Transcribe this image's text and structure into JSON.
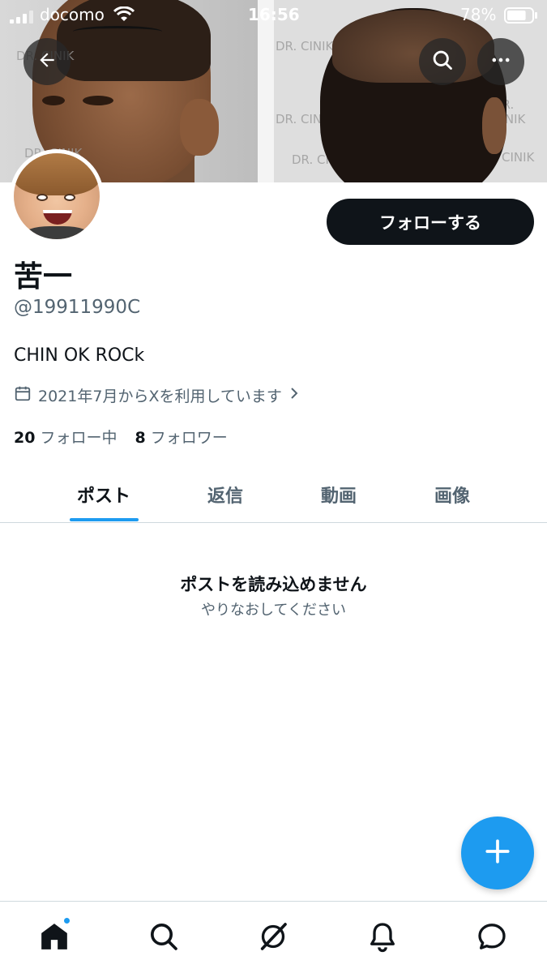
{
  "status_bar": {
    "carrier": "docomo",
    "time": "16:56",
    "battery": "78%",
    "battery_level": 0.78
  },
  "banner": {
    "watermark": "DR. CINIK"
  },
  "profile": {
    "follow_label": "フォローする",
    "display_name": "苦一",
    "handle": "@19911990C",
    "bio": "CHIN OK ROCk",
    "joined": "2021年7月からXを利用しています",
    "following_count": "20",
    "following_label": "フォロー中",
    "followers_count": "8",
    "followers_label": "フォロワー"
  },
  "tabs": [
    {
      "label": "ポスト",
      "active": true
    },
    {
      "label": "返信",
      "active": false
    },
    {
      "label": "動画",
      "active": false
    },
    {
      "label": "画像",
      "active": false
    }
  ],
  "empty_state": {
    "title": "ポストを読み込めません",
    "subtitle": "やりなおしてください"
  },
  "icons": {
    "back": "arrow-left-icon",
    "search": "search-icon",
    "more": "more-icon",
    "calendar": "calendar-icon",
    "compose": "plus-icon",
    "nav": [
      "home-icon",
      "search-icon",
      "grok-icon",
      "bell-icon",
      "messages-icon"
    ]
  },
  "colors": {
    "accent": "#1d9bf0",
    "text_primary": "#0f1419",
    "text_secondary": "#536471"
  }
}
